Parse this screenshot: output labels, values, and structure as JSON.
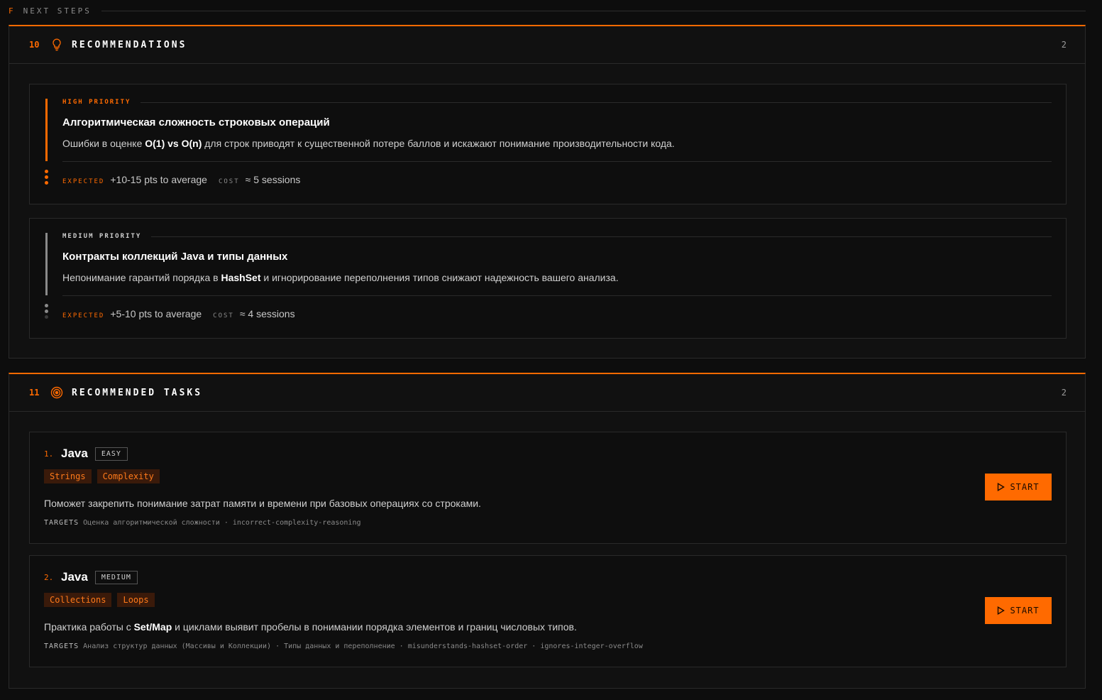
{
  "section": {
    "letter": "F",
    "label": "NEXT STEPS"
  },
  "recommendations": {
    "number": "10",
    "title": "RECOMMENDATIONS",
    "count": "2",
    "items": [
      {
        "priority": "HIGH PRIORITY",
        "title": "Алгоритмическая сложность строковых операций",
        "desc_pre": "Ошибки в оценке ",
        "desc_bold": "O(1) vs O(n)",
        "desc_post": " для строк приводят к существенной потере баллов и искажают понимание производительности кода.",
        "expected_label": "EXPECTED",
        "expected_value": "+10-15 pts to average",
        "cost_label": "COST",
        "cost_value": "≈ 5 sessions"
      },
      {
        "priority": "MEDIUM PRIORITY",
        "title_pre": "Контракты коллекций ",
        "title_bold": "Java",
        "title_post": " и типы данных",
        "desc_pre": "Непонимание гарантий порядка в ",
        "desc_bold": "HashSet",
        "desc_post": " и игнорирование переполнения типов снижают надежность вашего анализа.",
        "expected_label": "EXPECTED",
        "expected_value": "+5-10 pts to average",
        "cost_label": "COST",
        "cost_value": "≈ 4 sessions"
      }
    ]
  },
  "tasks": {
    "number": "11",
    "title": "RECOMMENDED TASKS",
    "count": "2",
    "items": [
      {
        "index": "1.",
        "language": "Java",
        "difficulty": "EASY",
        "tags": [
          "Strings",
          "Complexity"
        ],
        "desc": "Поможет закрепить понимание затрат памяти и времени при базовых операциях со строками.",
        "targets_label": "TARGETS",
        "targets": "Оценка алгоритмической сложности · incorrect-complexity-reasoning",
        "button": "START"
      },
      {
        "index": "2.",
        "language": "Java",
        "difficulty": "MEDIUM",
        "tags": [
          "Collections",
          "Loops"
        ],
        "desc_pre": "Практика работы с ",
        "desc_bold": "Set/Map",
        "desc_post": " и циклами выявит пробелы в понимании порядка элементов и границ числовых типов.",
        "targets_label": "TARGETS",
        "targets": "Анализ структур данных (Массивы и Коллекции) · Типы данных и переполнение · misunderstands-hashset-order · ignores-integer-overflow",
        "button": "START"
      }
    ]
  },
  "colors": {
    "accent": "#ff6a00",
    "background": "#0d0d0d",
    "panel": "#111111",
    "border": "#2a2a2a"
  },
  "icons": {
    "recommendations": "lightbulb-icon",
    "tasks": "target-icon",
    "start": "play-icon"
  }
}
